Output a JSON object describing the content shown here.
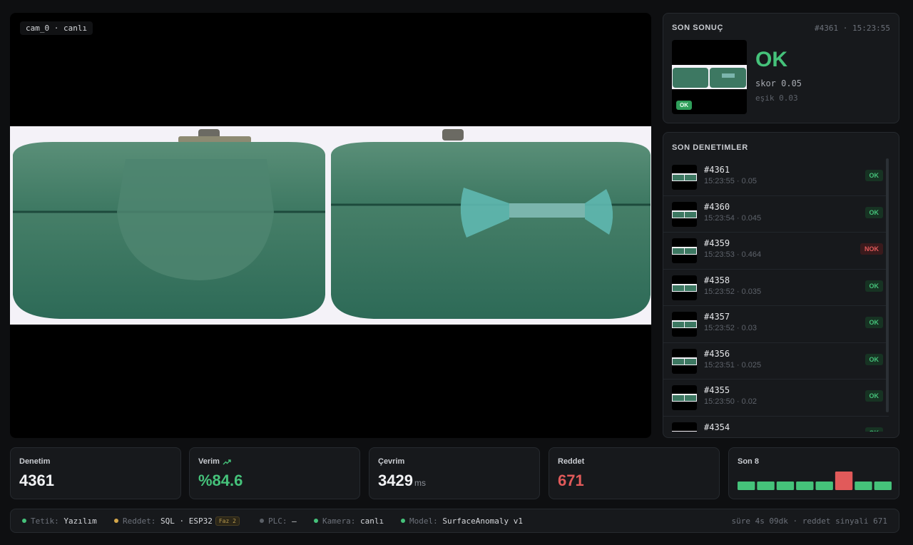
{
  "camera": {
    "label": "cam_0 · canlı"
  },
  "last_result": {
    "title": "SON SONUÇ",
    "meta": "#4361 · 15:23:55",
    "verdict": "OK",
    "score": "skor 0.05",
    "threshold": "eşik 0.03",
    "thumb_badge": "OK"
  },
  "recent": {
    "title": "SON DENETIMLER",
    "items": [
      {
        "id": "#4361",
        "meta": "15:23:55 · 0.05",
        "status": "OK"
      },
      {
        "id": "#4360",
        "meta": "15:23:54 · 0.045",
        "status": "OK"
      },
      {
        "id": "#4359",
        "meta": "15:23:53 · 0.464",
        "status": "NOK"
      },
      {
        "id": "#4358",
        "meta": "15:23:52 · 0.035",
        "status": "OK"
      },
      {
        "id": "#4357",
        "meta": "15:23:52 · 0.03",
        "status": "OK"
      },
      {
        "id": "#4356",
        "meta": "15:23:51 · 0.025",
        "status": "OK"
      },
      {
        "id": "#4355",
        "meta": "15:23:50 · 0.02",
        "status": "OK"
      },
      {
        "id": "#4354",
        "meta": "",
        "status": "OK"
      }
    ]
  },
  "stats": {
    "inspection": {
      "label": "Denetim",
      "value": "4361"
    },
    "yield": {
      "label": "Verim",
      "value": "%84.6"
    },
    "cycle": {
      "label": "Çevrim",
      "value": "3429",
      "unit": "ms"
    },
    "reject": {
      "label": "Reddet",
      "value": "671"
    },
    "last8": {
      "label": "Son 8",
      "results": [
        "OK",
        "OK",
        "OK",
        "OK",
        "OK",
        "NOK",
        "OK",
        "OK"
      ]
    }
  },
  "footer": {
    "trigger": {
      "key": "Tetik:",
      "value": "Yazılım"
    },
    "reject": {
      "key": "Reddet:",
      "value": "SQL · ESP32",
      "phase": "Faz 2"
    },
    "plc": {
      "key": "PLC:",
      "value": "—"
    },
    "camera": {
      "key": "Kamera:",
      "value": "canlı"
    },
    "model": {
      "key": "Model:",
      "value": "SurfaceAnomaly v1"
    },
    "right": "süre 4s 09dk · reddet sinyali 671"
  },
  "colors": {
    "ok": "#45c27a",
    "nok": "#e15a5a",
    "background": "#0e0f11",
    "panel": "#17191c",
    "part_green": "#3f8a6b"
  }
}
